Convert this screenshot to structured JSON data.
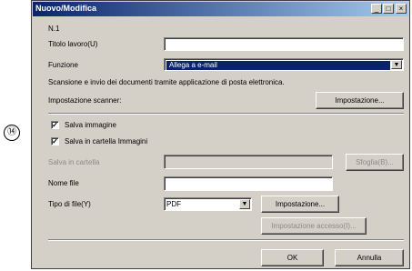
{
  "step_marker": "⑭",
  "window": {
    "title": "Nuovo/Modifica",
    "controls": {
      "minimize": "_",
      "maximize": "□",
      "close": "×"
    }
  },
  "form": {
    "number_label": "N.1",
    "job_title_label": "Titolo lavoro(U)",
    "job_title_value": "",
    "function_label": "Funzione",
    "function_value": "Allega a e-mail",
    "description": "Scansione e invio dei documenti tramite applicazione di posta elettronica.",
    "scanner_setting_label": "Impostazione scanner:",
    "scanner_setting_button": "Impostazione...",
    "save_image_label": "Salva immagine",
    "save_image_checked": true,
    "save_in_images_label": "Salva in cartella Immagini",
    "save_in_images_checked": true,
    "save_in_folder_label": "Salva in cartella",
    "save_in_folder_value": "",
    "browse_button": "Sfoglia(B)...",
    "file_name_label": "Nome file",
    "file_name_value": "",
    "file_type_label": "Tipo di file(Y)",
    "file_type_value": "PDF",
    "file_type_setting_button": "Impostazione...",
    "access_setting_button": "Impostazione accesso(I)...",
    "ok_button": "OK",
    "cancel_button": "Annulla"
  }
}
